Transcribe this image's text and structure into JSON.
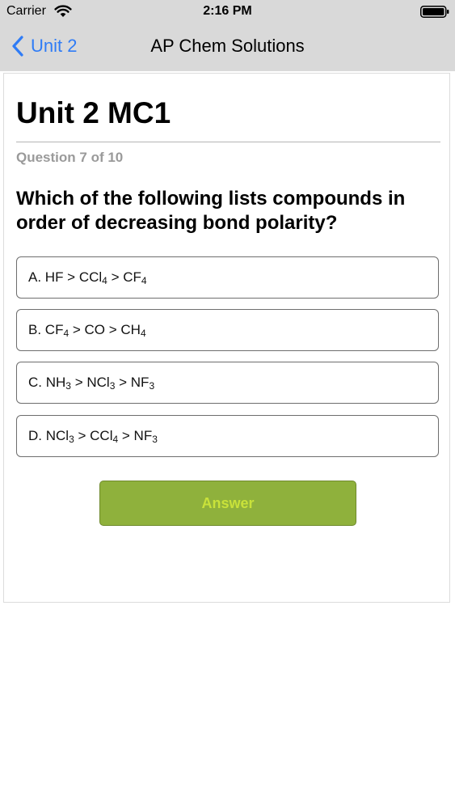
{
  "status_bar": {
    "carrier": "Carrier",
    "time": "2:16 PM"
  },
  "nav": {
    "back_label": "Unit 2",
    "title": "AP Chem Solutions"
  },
  "quiz": {
    "title": "Unit 2 MC1",
    "counter": "Question 7 of 10",
    "question": "Which of the following lists compounds in order of decreasing bond polarity?"
  },
  "options": [
    {
      "prefix": "A.",
      "parts": [
        {
          "t": "HF > CCl"
        },
        {
          "sub": "4"
        },
        {
          "t": " > CF"
        },
        {
          "sub": "4"
        }
      ]
    },
    {
      "prefix": "B.",
      "parts": [
        {
          "t": "CF"
        },
        {
          "sub": "4"
        },
        {
          "t": " > CO > CH"
        },
        {
          "sub": "4"
        }
      ]
    },
    {
      "prefix": "C.",
      "parts": [
        {
          "t": "NH"
        },
        {
          "sub": "3"
        },
        {
          "t": " > NCl"
        },
        {
          "sub": "3"
        },
        {
          "t": " > NF"
        },
        {
          "sub": "3"
        }
      ]
    },
    {
      "prefix": "D.",
      "parts": [
        {
          "t": "NCl"
        },
        {
          "sub": "3"
        },
        {
          "t": " > CCl"
        },
        {
          "sub": "4"
        },
        {
          "t": " > NF"
        },
        {
          "sub": "3"
        }
      ]
    }
  ],
  "answer_button": {
    "label": "Answer"
  },
  "colors": {
    "nav_background": "#d9d9d9",
    "link_blue": "#2f7cf6",
    "answer_fill": "#8fb13c",
    "answer_text": "#c9e23a",
    "counter_gray": "#9a9a9a"
  },
  "icons": {
    "wifi": "wifi-icon",
    "battery": "battery-icon",
    "back": "chevron-left-icon"
  }
}
